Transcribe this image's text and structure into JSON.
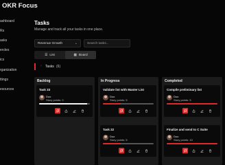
{
  "app": {
    "title": "OKR Focus"
  },
  "sidebar": {
    "items": [
      {
        "label": "ashboard"
      },
      {
        "label": "Rs"
      },
      {
        "label": "asks"
      },
      {
        "label": "ercles"
      },
      {
        "label": "ics"
      },
      {
        "label": "rganization"
      },
      {
        "label": "ttings"
      },
      {
        "label": "esources"
      }
    ]
  },
  "page": {
    "title": "Tasks",
    "subtitle": "Manage and track all your tasks in one place."
  },
  "filters": {
    "objective_value": "Revenue Growth",
    "search_placeholder": "Search tasks..."
  },
  "view_toggle": {
    "list_label": "List",
    "board_label": "Board",
    "active": "Board"
  },
  "tasks_section": {
    "label": "Tasks",
    "count": "(6)"
  },
  "columns": [
    {
      "title": "Backlog",
      "cards": [
        {
          "title": "Task 33",
          "owner": "Duo",
          "points": "Story points: 0",
          "progress": 0.95,
          "progress_color": "white"
        }
      ]
    },
    {
      "title": "In Progress",
      "cards": [
        {
          "title": "Validate list with Master List",
          "owner": "Duo",
          "points": "Story points: 5",
          "progress": 0.35,
          "progress_color": "red"
        },
        {
          "title": "Task 22",
          "owner": "Duo",
          "points": "Story points: 5",
          "progress": 0.35,
          "progress_color": "red"
        }
      ]
    },
    {
      "title": "Completed",
      "cards": [
        {
          "title": "Compile preliminary list",
          "owner": "Duo",
          "points": "Story points: 5",
          "progress": 1.0,
          "progress_color": "red"
        },
        {
          "title": "Finalize and send to C Suite",
          "owner": "Duo",
          "points": "Story points: 10",
          "progress": 1.0,
          "progress_color": "red"
        }
      ]
    }
  ],
  "icons": {
    "primary_action": "flag-icon",
    "edit": "edit-icon",
    "share": "share-icon",
    "delete": "trash-icon"
  },
  "colors": {
    "accent": "#e02a2a",
    "background": "#060606",
    "column": "#1b1b1b",
    "card": "#0a0a0a"
  }
}
